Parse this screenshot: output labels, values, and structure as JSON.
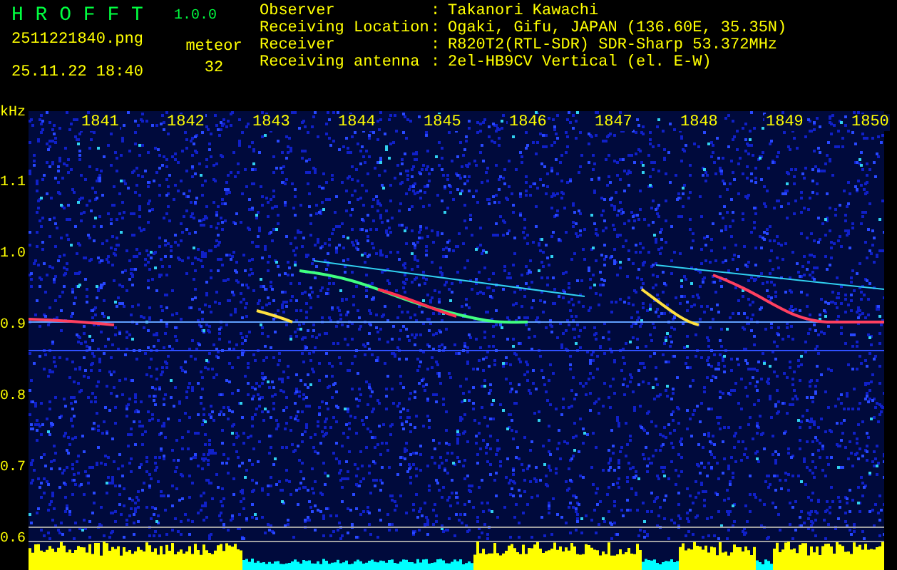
{
  "app": {
    "title": "H R O F F T",
    "version": "1.0.0"
  },
  "file": {
    "name": "2511221840.png",
    "datetime": "25.11.22 18:40"
  },
  "meteor": {
    "label": "meteor",
    "count": "32"
  },
  "station": [
    {
      "label": "Observer",
      "separator": ":",
      "value": "Takanori Kawachi"
    },
    {
      "label": "Receiving Location",
      "separator": ":",
      "value": "Ogaki, Gifu, JAPAN (136.60E, 35.35N)"
    },
    {
      "label": "Receiver",
      "separator": ":",
      "value": "R820T2(RTL-SDR) SDR-Sharp 53.372MHz"
    },
    {
      "label": "Receiving antenna",
      "separator": ":",
      "value": "2el-HB9CV Vertical (el. E-W)"
    }
  ],
  "plot": {
    "y_unit": "kHz",
    "y_labels": [
      "1.1",
      "1.0",
      "0.9",
      "0.8",
      "0.7",
      "0.6"
    ],
    "x_labels": [
      "1841",
      "1842",
      "1843",
      "1844",
      "1845",
      "1846",
      "1847",
      "1848",
      "1849",
      "1850"
    ]
  }
}
